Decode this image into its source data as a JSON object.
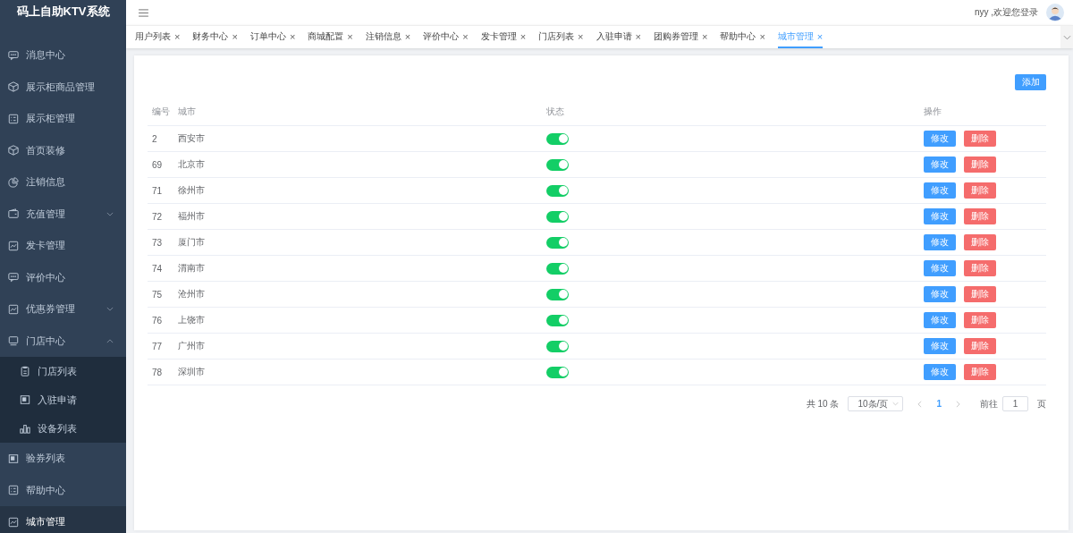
{
  "sidebar": {
    "title": "码上自助KTV系统",
    "items": [
      {
        "label": "消息中心",
        "kind": "link",
        "selected": false
      },
      {
        "label": "展示柜商品管理",
        "kind": "link",
        "selected": false
      },
      {
        "label": "展示柜管理",
        "kind": "link",
        "selected": false
      },
      {
        "label": "首页装修",
        "kind": "link",
        "selected": false
      },
      {
        "label": "注销信息",
        "kind": "link",
        "selected": false
      },
      {
        "label": "充值管理",
        "kind": "group",
        "selected": false,
        "expanded": false
      },
      {
        "label": "发卡管理",
        "kind": "link",
        "selected": false
      },
      {
        "label": "评价中心",
        "kind": "link",
        "selected": false
      },
      {
        "label": "优惠券管理",
        "kind": "group",
        "selected": false,
        "expanded": false
      },
      {
        "label": "门店中心",
        "kind": "group",
        "selected": false,
        "expanded": true,
        "children": [
          {
            "label": "门店列表",
            "selected": false
          },
          {
            "label": "入驻申请",
            "selected": false
          },
          {
            "label": "设备列表",
            "selected": false
          }
        ]
      },
      {
        "label": "验券列表",
        "kind": "link",
        "selected": false
      },
      {
        "label": "帮助中心",
        "kind": "link",
        "selected": false
      },
      {
        "label": "城市管理",
        "kind": "link",
        "selected": true
      }
    ]
  },
  "header": {
    "user_greeting": "nyy ,欢迎您登录"
  },
  "tabs": [
    {
      "label": "用户列表",
      "close": "×",
      "selected": false
    },
    {
      "label": "财务中心",
      "close": "×",
      "selected": false
    },
    {
      "label": "订单中心",
      "close": "×",
      "selected": false
    },
    {
      "label": "商城配置",
      "close": "×",
      "selected": false
    },
    {
      "label": "注销信息",
      "close": "×",
      "selected": false
    },
    {
      "label": "评价中心",
      "close": "×",
      "selected": false
    },
    {
      "label": "发卡管理",
      "close": "×",
      "selected": false
    },
    {
      "label": "门店列表",
      "close": "×",
      "selected": false
    },
    {
      "label": "入驻申请",
      "close": "×",
      "selected": false
    },
    {
      "label": "团购券管理",
      "close": "×",
      "selected": false
    },
    {
      "label": "帮助中心",
      "close": "×",
      "selected": false
    },
    {
      "label": "城市管理",
      "close": "×",
      "selected": true
    }
  ],
  "add_button": "添加",
  "table": {
    "columns": [
      "编号",
      "城市",
      "状态",
      "操作"
    ],
    "rows": [
      {
        "id": "2",
        "city": "西安市",
        "enabled": true,
        "actions": [
          "修改",
          "删除"
        ]
      },
      {
        "id": "69",
        "city": "北京市",
        "enabled": true,
        "actions": [
          "修改",
          "删除"
        ]
      },
      {
        "id": "71",
        "city": "徐州市",
        "enabled": true,
        "actions": [
          "修改",
          "删除"
        ]
      },
      {
        "id": "72",
        "city": "福州市",
        "enabled": true,
        "actions": [
          "修改",
          "删除"
        ]
      },
      {
        "id": "73",
        "city": "厦门市",
        "enabled": true,
        "actions": [
          "修改",
          "删除"
        ]
      },
      {
        "id": "74",
        "city": "渭南市",
        "enabled": true,
        "actions": [
          "修改",
          "删除"
        ]
      },
      {
        "id": "75",
        "city": "沧州市",
        "enabled": true,
        "actions": [
          "修改",
          "删除"
        ]
      },
      {
        "id": "76",
        "city": "上饶市",
        "enabled": true,
        "actions": [
          "修改",
          "删除"
        ]
      },
      {
        "id": "77",
        "city": "广州市",
        "enabled": true,
        "actions": [
          "修改",
          "删除"
        ]
      },
      {
        "id": "78",
        "city": "深圳市",
        "enabled": true,
        "actions": [
          "修改",
          "删除"
        ]
      }
    ]
  },
  "pagination": {
    "total": "共 10 条",
    "page_size": "10条/页",
    "pages": [
      {
        "label": "1",
        "selected": true
      }
    ],
    "jump_label": "前往",
    "jump_value": "1",
    "jump_suffix": "页"
  }
}
